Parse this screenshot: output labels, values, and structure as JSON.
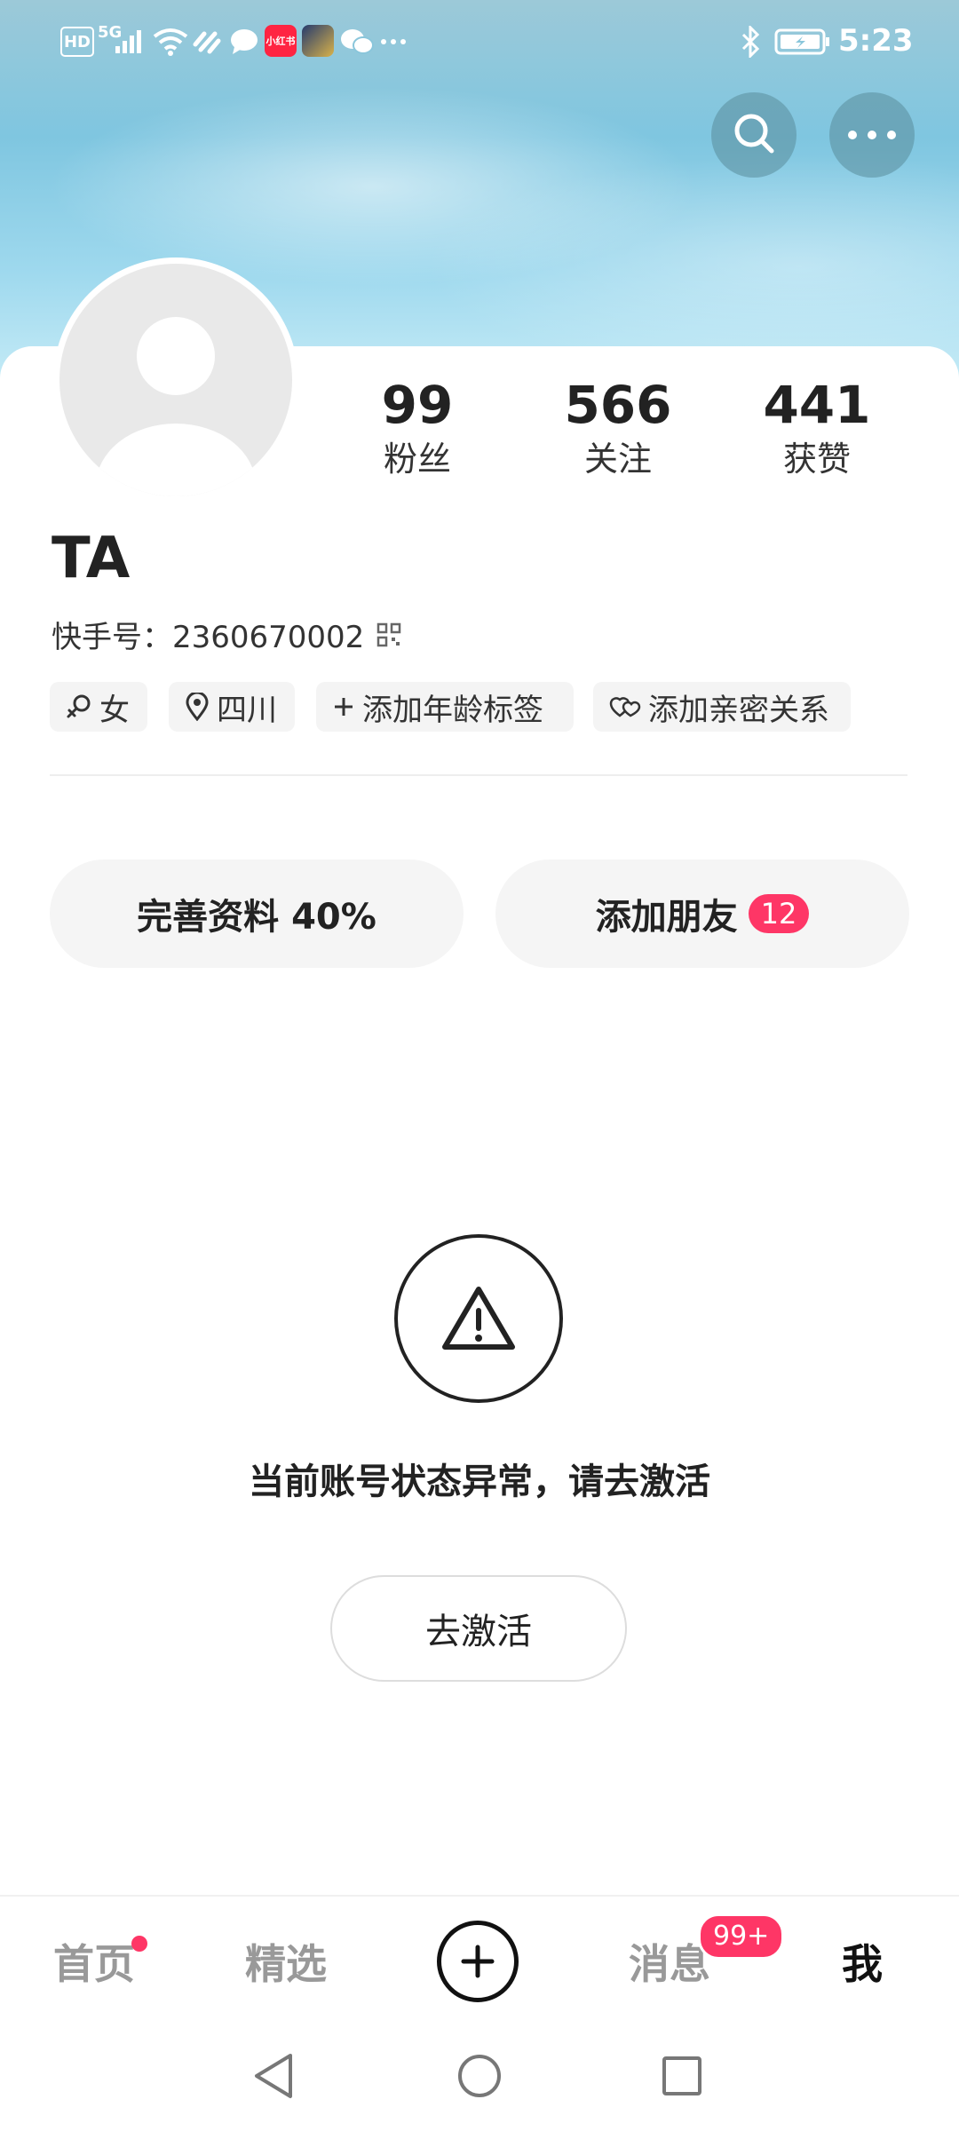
{
  "status_bar": {
    "time": "5:23",
    "network": "5G",
    "hd": "HD",
    "app_badge": "小红书"
  },
  "header": {
    "search_icon": "search-icon",
    "more_icon": "more-horizontal-icon"
  },
  "profile": {
    "stats": [
      {
        "value": "99",
        "label": "粉丝"
      },
      {
        "value": "566",
        "label": "关注"
      },
      {
        "value": "441",
        "label": "获赞"
      }
    ],
    "name": "TA",
    "kuaishou_id": "快手号：2360670002",
    "tags": [
      {
        "icon": "female-icon",
        "label": "女"
      },
      {
        "icon": "location-icon",
        "label": "四川"
      },
      {
        "icon": "plus-icon",
        "label": "添加年龄标签"
      },
      {
        "icon": "hearts-icon",
        "label": "添加亲密关系"
      }
    ]
  },
  "actions": {
    "complete_profile": "完善资料 40%",
    "add_friends": "添加朋友",
    "add_friends_badge": "12"
  },
  "notice": {
    "message": "当前账号状态异常，请去激活",
    "button": "去激活"
  },
  "bottom_nav": {
    "items": [
      "首页",
      "精选",
      "消息",
      "我"
    ],
    "messages_badge": "99+",
    "active": "我"
  },
  "colors": {
    "accent": "#fe3666",
    "text": "#222222",
    "pill_bg": "#f5f5f5"
  }
}
